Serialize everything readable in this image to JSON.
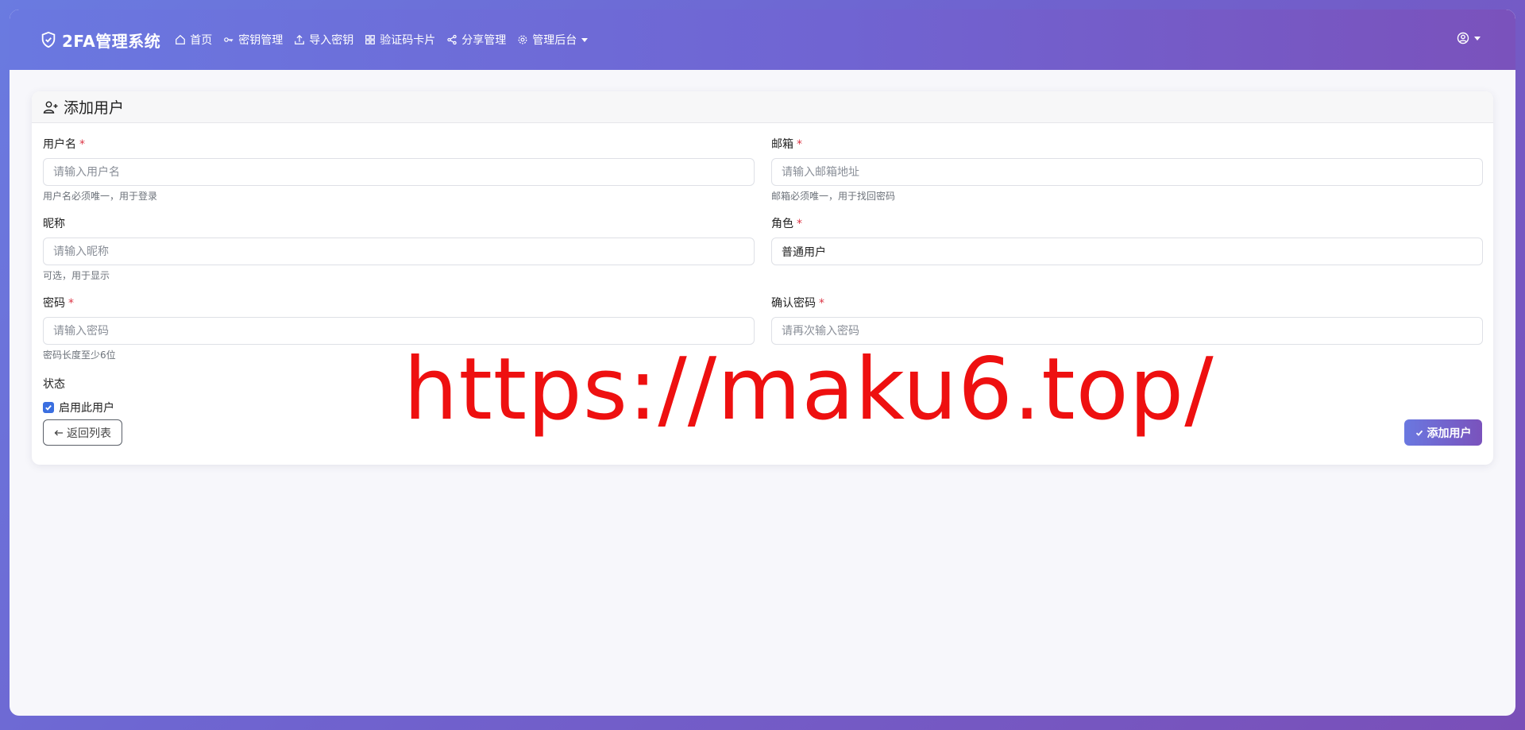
{
  "navbar": {
    "brand": "2FA管理系统",
    "items": [
      {
        "label": "首页",
        "icon": "home-icon"
      },
      {
        "label": "密钥管理",
        "icon": "key-icon"
      },
      {
        "label": "导入密钥",
        "icon": "upload-icon"
      },
      {
        "label": "验证码卡片",
        "icon": "grid-icon"
      },
      {
        "label": "分享管理",
        "icon": "share-icon"
      },
      {
        "label": "管理后台",
        "icon": "gear-icon"
      }
    ],
    "user_icon": "user-circle-icon"
  },
  "card": {
    "title": "添加用户",
    "fields": {
      "username": {
        "label": "用户名",
        "required": "*",
        "placeholder": "请输入用户名",
        "help": "用户名必须唯一，用于登录"
      },
      "email": {
        "label": "邮箱",
        "required": "*",
        "placeholder": "请输入邮箱地址",
        "help": "邮箱必须唯一，用于找回密码"
      },
      "nickname": {
        "label": "昵称",
        "placeholder": "请输入昵称",
        "help": "可选，用于显示"
      },
      "role": {
        "label": "角色",
        "required": "*",
        "value": "普通用户"
      },
      "password": {
        "label": "密码",
        "required": "*",
        "placeholder": "请输入密码",
        "help": "密码长度至少6位"
      },
      "confirm_password": {
        "label": "确认密码",
        "required": "*",
        "placeholder": "请再次输入密码"
      }
    },
    "status": {
      "label": "状态",
      "checkbox_label": "启用此用户",
      "checked": true
    },
    "back_button": "返回列表",
    "submit_button": "添加用户"
  },
  "watermark": "https://maku6.top/",
  "colors": {
    "accent_start": "#6a78e0",
    "accent_end": "#7a52bc",
    "required": "#dc3545",
    "checkbox": "#3b6fe0",
    "watermark": "#ee1010"
  }
}
